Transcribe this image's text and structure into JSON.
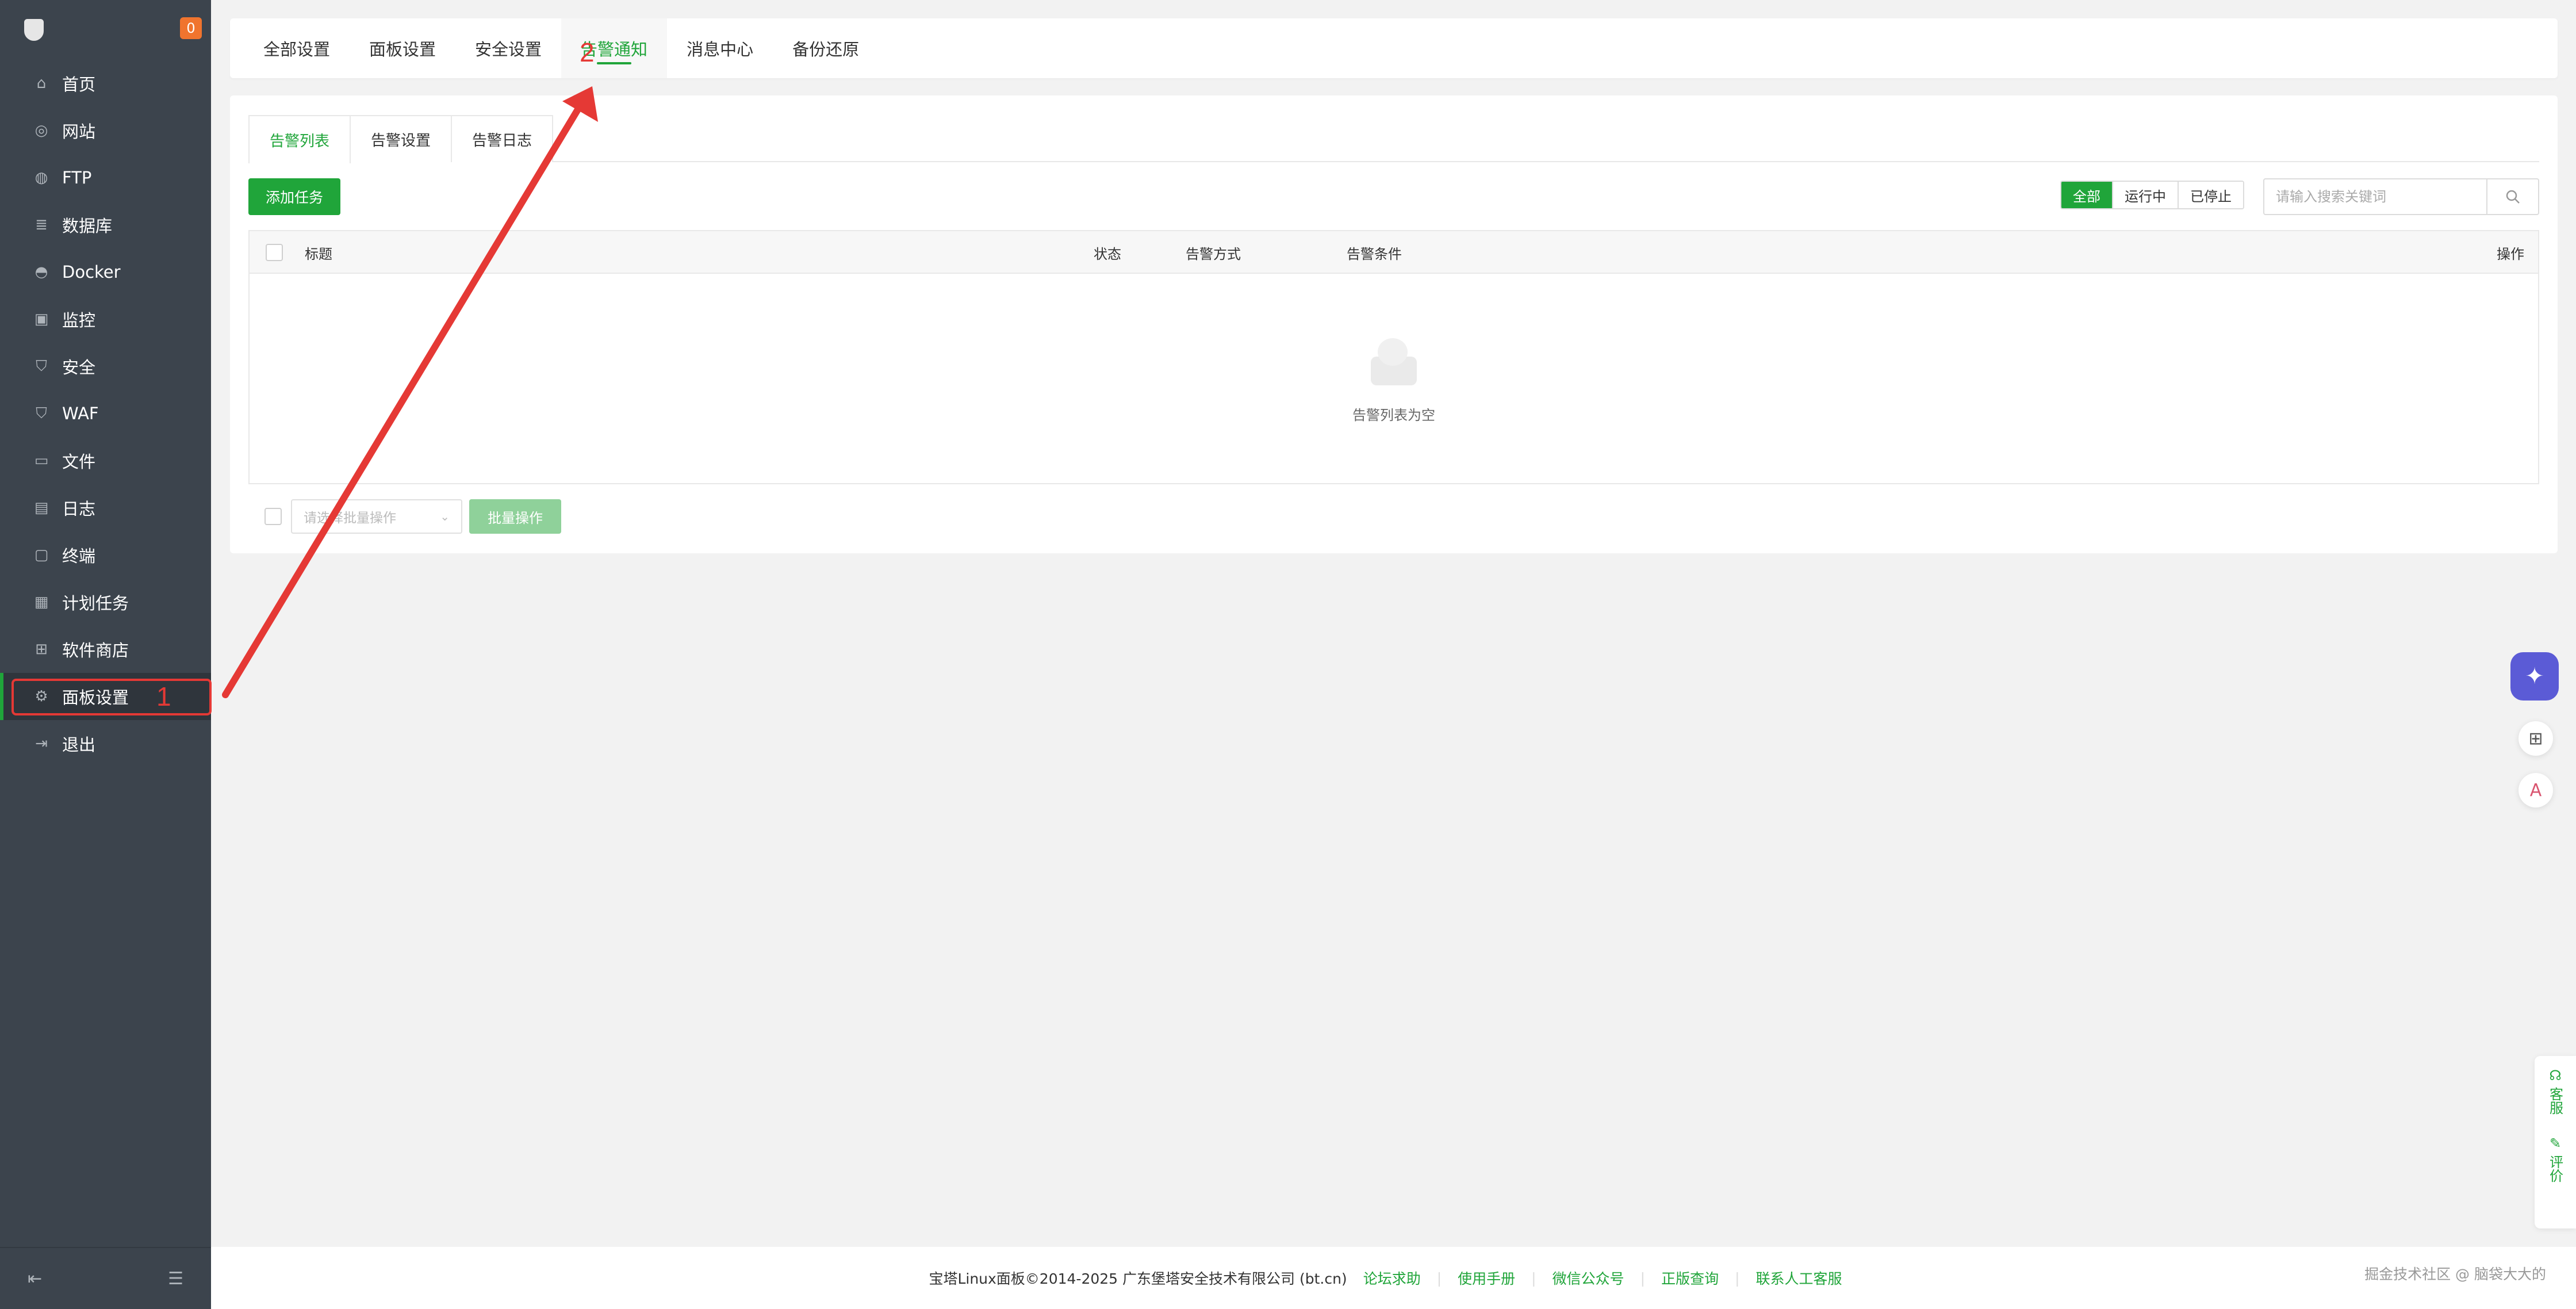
{
  "sidebar": {
    "badge": "0",
    "items": [
      {
        "label": "首页",
        "icon": "⌂"
      },
      {
        "label": "网站",
        "icon": "◎"
      },
      {
        "label": "FTP",
        "icon": "◍"
      },
      {
        "label": "数据库",
        "icon": "≣"
      },
      {
        "label": "Docker",
        "icon": "◓"
      },
      {
        "label": "监控",
        "icon": "▣"
      },
      {
        "label": "安全",
        "icon": "⛉"
      },
      {
        "label": "WAF",
        "icon": "⛉"
      },
      {
        "label": "文件",
        "icon": "▭"
      },
      {
        "label": "日志",
        "icon": "▤"
      },
      {
        "label": "终端",
        "icon": "▢"
      },
      {
        "label": "计划任务",
        "icon": "▦"
      },
      {
        "label": "软件商店",
        "icon": "⊞"
      },
      {
        "label": "面板设置",
        "icon": "⚙"
      },
      {
        "label": "退出",
        "icon": "⇥"
      }
    ],
    "collapse_icon_left": "⇤",
    "collapse_icon_right": "☰"
  },
  "annotations": {
    "step1": "1",
    "step2": "2",
    "color": "#e53935"
  },
  "topnav": {
    "tabs": [
      {
        "label": "全部设置"
      },
      {
        "label": "面板设置"
      },
      {
        "label": "安全设置"
      },
      {
        "label": "告警通知"
      },
      {
        "label": "消息中心"
      },
      {
        "label": "备份还原"
      }
    ]
  },
  "subtabs": [
    {
      "label": "告警列表"
    },
    {
      "label": "告警设置"
    },
    {
      "label": "告警日志"
    }
  ],
  "toolbar": {
    "add_label": "添加任务",
    "filters": [
      {
        "label": "全部"
      },
      {
        "label": "运行中"
      },
      {
        "label": "已停止"
      }
    ],
    "search_placeholder": "请输入搜索关键词"
  },
  "table": {
    "columns": {
      "title": "标题",
      "status": "状态",
      "method": "告警方式",
      "condition": "告警条件",
      "action": "操作"
    },
    "empty_text": "告警列表为空"
  },
  "batch": {
    "select_placeholder": "请选择批量操作",
    "button_label": "批量操作"
  },
  "side_service": {
    "service_label": "客服",
    "review_label": "评价"
  },
  "footer": {
    "copyright": "宝塔Linux面板©2014-2025 广东堡塔安全技术有限公司 (bt.cn)",
    "links": [
      {
        "label": "论坛求助"
      },
      {
        "label": "使用手册"
      },
      {
        "label": "微信公众号"
      },
      {
        "label": "正版查询"
      },
      {
        "label": "联系人工客服"
      }
    ],
    "watermark": "掘金技术社区 @ 脑袋大大的"
  },
  "colors": {
    "accent": "#20a53a",
    "sidebar": "#3c444d",
    "badge": "#f0742e"
  }
}
